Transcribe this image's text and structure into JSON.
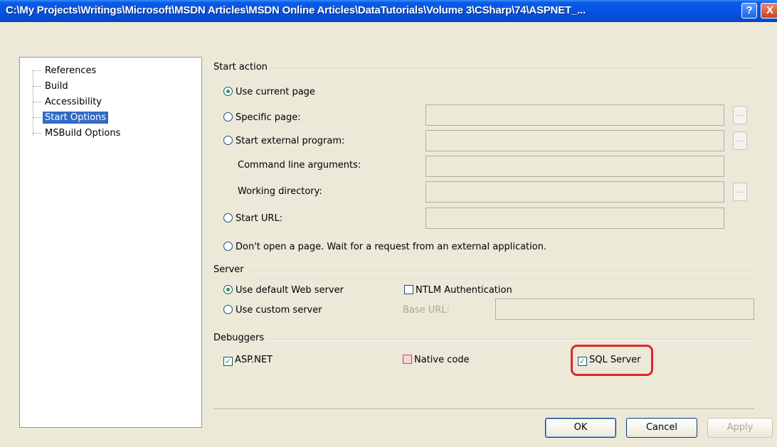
{
  "window": {
    "title": "C:\\My Projects\\Writings\\Microsoft\\MSDN Articles\\MSDN Online Articles\\DataTutorials\\Volume 3\\CSharp\\74\\ASPNET_...",
    "help_glyph": "?",
    "close_glyph": "X"
  },
  "tree": {
    "items": [
      "References",
      "Build",
      "Accessibility",
      "Start Options",
      "MSBuild Options"
    ],
    "selected": "Start Options"
  },
  "start_action": {
    "group_label": "Start action",
    "use_current_page": "Use current page",
    "specific_page": "Specific page:",
    "start_external_program": "Start external program:",
    "command_line_arguments": "Command line arguments:",
    "working_directory": "Working directory:",
    "start_url": "Start URL:",
    "dont_open_page": "Don't open a page. Wait for a request from an external application.",
    "browse_glyph": "...",
    "selected_option": "Use current page"
  },
  "server": {
    "group_label": "Server",
    "use_default_web_server": "Use default Web server",
    "use_custom_server": "Use custom server",
    "ntlm_authentication": "NTLM Authentication",
    "base_url": "Base URL:",
    "ntlm_checked": false
  },
  "debuggers": {
    "group_label": "Debuggers",
    "aspnet": "ASP.NET",
    "native_code": "Native code",
    "sql_server": "SQL Server",
    "aspnet_checked": true,
    "native_checked": false,
    "sql_checked": true,
    "check_glyph": "✓"
  },
  "buttons": {
    "ok": "OK",
    "cancel": "Cancel",
    "apply": "Apply"
  },
  "colors": {
    "highlight": "#e0242c",
    "titlebar": "#0553e0",
    "selection": "#316ac5"
  }
}
